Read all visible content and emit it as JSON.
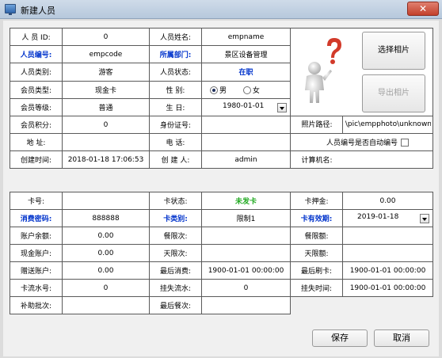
{
  "window": {
    "title": "新建人员",
    "close_glyph": "✕"
  },
  "section1": {
    "id_label": "人 员 ID:",
    "id_value": "0",
    "name_label": "人员姓名:",
    "name_value": "empname",
    "code_label": "人员编号:",
    "code_value": "empcode",
    "dept_label": "所属部门:",
    "dept_value": "景区设备管理",
    "category_label": "人员类别:",
    "category_value": "游客",
    "status_label": "人员状态:",
    "status_value": "在职",
    "member_type_label": "会员类型:",
    "member_type_value": "现金卡",
    "gender_label": "性    别:",
    "gender_male": "男",
    "gender_female": "女",
    "gender_selected": "男",
    "member_level_label": "会员等级:",
    "member_level_value": "普通",
    "birthday_label": "生    日:",
    "birthday_value": "1980-01-01",
    "points_label": "会员积分:",
    "points_value": "0",
    "idcard_label": "身份证号:",
    "idcard_value": "",
    "photo_path_label": "照片路径:",
    "photo_path_value": "\\pic\\empphoto\\unknown.jpg",
    "address_label": "地    址:",
    "address_value": "",
    "phone_label": "电    话:",
    "phone_value": "",
    "auto_code_label": "人员编号是否自动编号",
    "created_label": "创建时间:",
    "created_value": "2018-01-18 17:06:53",
    "creator_label": "创 建 人:",
    "creator_value": "admin",
    "computer_label": "计算机名:",
    "computer_value": "",
    "select_photo_btn": "选择相片",
    "export_photo_btn": "导出相片"
  },
  "section2": {
    "card_no_label": "卡号:",
    "card_no_value": "",
    "card_state_label": "卡状态:",
    "card_state_value": "未发卡",
    "deposit_label": "卡押金:",
    "deposit_value": "0.00",
    "pwd_label": "消费密码:",
    "pwd_value": "888888",
    "card_type_label": "卡类别:",
    "card_type_value": "限制1",
    "expiry_label": "卡有效期:",
    "expiry_value": "2019-01-18",
    "balance_label": "账户余额:",
    "balance_value": "0.00",
    "meal_limit_label": "餐限次:",
    "meal_limit_value": "",
    "meal_amount_label": "餐限额:",
    "meal_amount_value": "",
    "cash_label": "现金账户:",
    "cash_value": "0.00",
    "day_limit_label": "天限次:",
    "day_limit_value": "",
    "day_amount_label": "天限额:",
    "day_amount_value": "",
    "gift_label": "赠送账户:",
    "gift_value": "0.00",
    "last_consume_label": "最后消费:",
    "last_consume_value": "1900-01-01 00:00:00",
    "last_swipe_label": "最后刷卡:",
    "last_swipe_value": "1900-01-01 00:00:00",
    "serial_label": "卡流水号:",
    "serial_value": "0",
    "loss_serial_label": "挂失流水:",
    "loss_serial_value": "0",
    "loss_time_label": "挂失时间:",
    "loss_time_value": "1900-01-01 00:00:00",
    "subsidy_label": "补助批次:",
    "subsidy_value": "",
    "last_meal_label": "最后餐次:",
    "last_meal_value": ""
  },
  "buttons": {
    "save": "保存",
    "cancel": "取消"
  },
  "colors": {
    "accent_blue": "#0033cc",
    "status_green": "#22aa22",
    "question_red": "#d23a2a"
  }
}
